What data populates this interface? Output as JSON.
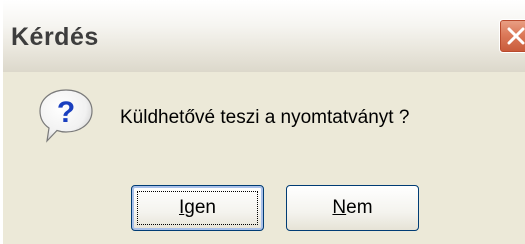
{
  "window": {
    "title": "Kérdés"
  },
  "titlebar": {
    "close_icon": "close-icon",
    "close_color": "#d9694a"
  },
  "dialog": {
    "icon": "question-icon",
    "message": "Küldhetővé teszi a nyomtatványt ?"
  },
  "buttons": {
    "yes": {
      "first": "I",
      "rest": "gen"
    },
    "no": {
      "first": "N",
      "rest": "em"
    }
  },
  "colors": {
    "dialog_bg": "#ece9d8",
    "button_border": "#003c74",
    "icon_blue": "#1a3fbf"
  }
}
